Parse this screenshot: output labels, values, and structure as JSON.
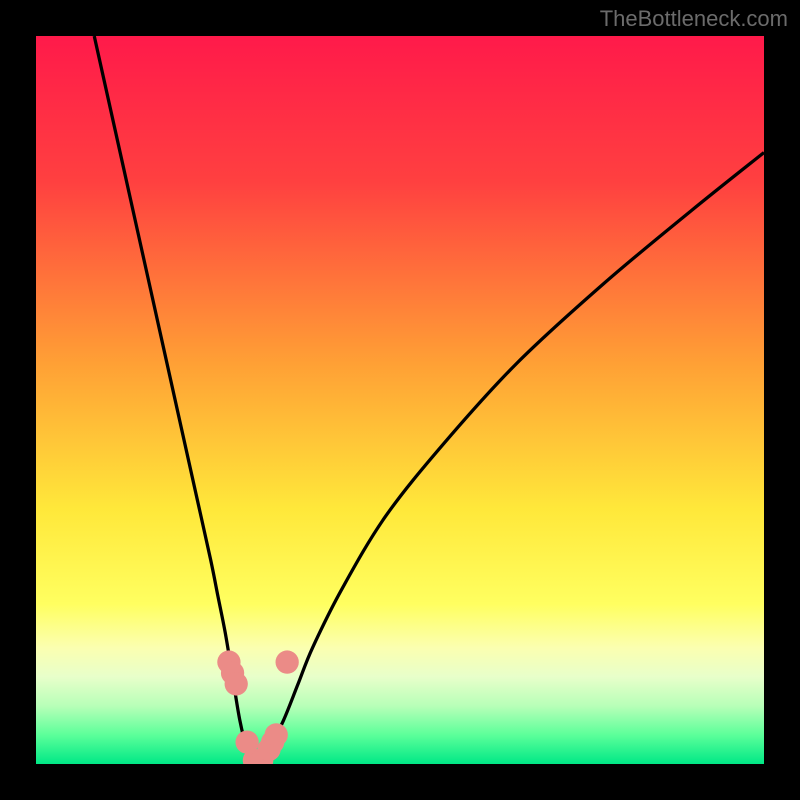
{
  "watermark": "TheBottleneck.com",
  "chart_data": {
    "type": "line",
    "title": "",
    "xlabel": "",
    "ylabel": "",
    "xlim": [
      0,
      100
    ],
    "ylim": [
      0,
      100
    ],
    "gradient_stops": [
      {
        "offset": 0,
        "color": "#ff1a4a"
      },
      {
        "offset": 20,
        "color": "#ff4040"
      },
      {
        "offset": 45,
        "color": "#ffa035"
      },
      {
        "offset": 65,
        "color": "#ffe83a"
      },
      {
        "offset": 78,
        "color": "#ffff60"
      },
      {
        "offset": 84,
        "color": "#fbffb0"
      },
      {
        "offset": 88,
        "color": "#e8ffca"
      },
      {
        "offset": 92,
        "color": "#b8ffb8"
      },
      {
        "offset": 96,
        "color": "#5cff9a"
      },
      {
        "offset": 100,
        "color": "#00e886"
      }
    ],
    "series": [
      {
        "name": "bottleneck-curve",
        "x": [
          8,
          10,
          12,
          14,
          16,
          18,
          20,
          22,
          24,
          25,
          26,
          27,
          28,
          29,
          30,
          31,
          32,
          34,
          36,
          38,
          42,
          48,
          56,
          66,
          78,
          90,
          100
        ],
        "y": [
          100,
          91,
          82,
          73,
          64,
          55,
          46,
          37,
          28,
          23,
          18,
          12,
          6,
          2,
          0,
          0,
          2,
          6,
          11,
          16,
          24,
          34,
          44,
          55,
          66,
          76,
          84
        ]
      }
    ],
    "markers": {
      "name": "highlight-points",
      "x": [
        26.5,
        27.0,
        27.5,
        29.0,
        30.0,
        31.0,
        32.0,
        32.5,
        33.0,
        34.5
      ],
      "y": [
        14,
        12.5,
        11,
        3,
        0.5,
        0.5,
        2,
        3,
        4,
        14
      ],
      "color": "#eb8b87",
      "radius_pct": 1.6
    }
  }
}
